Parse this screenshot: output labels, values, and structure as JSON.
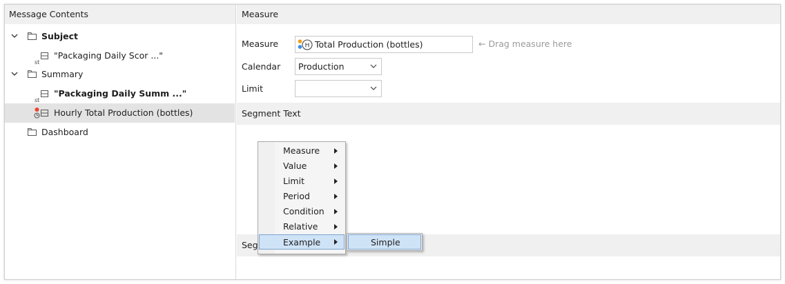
{
  "left_panel": {
    "title": "Message Contents",
    "tree": [
      {
        "label": "Subject"
      },
      {
        "tag": "st",
        "label": "\"Packaging Daily Scor ...\""
      },
      {
        "label": "Summary"
      },
      {
        "tag": "st",
        "label": "\"Packaging Daily Summ ...\""
      },
      {
        "label": "Hourly Total Production (bottles)"
      },
      {
        "label": "Dashboard"
      }
    ]
  },
  "right_panel": {
    "title": "Measure",
    "measure_label": "Measure",
    "measure_value": "Total Production (bottles)",
    "drag_hint": "← Drag measure here",
    "calendar_label": "Calendar",
    "calendar_value": "Production",
    "limit_label": "Limit",
    "limit_value": "",
    "segment_text_title": "Segment Text",
    "second_section_title": "Seg"
  },
  "context_menu": {
    "items": [
      {
        "label": "Measure"
      },
      {
        "label": "Value"
      },
      {
        "label": "Limit"
      },
      {
        "label": "Period"
      },
      {
        "label": "Condition"
      },
      {
        "label": "Relative"
      },
      {
        "label": "Example"
      }
    ],
    "submenu": {
      "label": "Simple"
    }
  },
  "colors": {
    "highlight": "#cfe3f7",
    "highlight_border": "#7da2ce",
    "alarm_dot": "#e8452c",
    "orange": "#f39c12",
    "blue": "#3a8ee6"
  }
}
